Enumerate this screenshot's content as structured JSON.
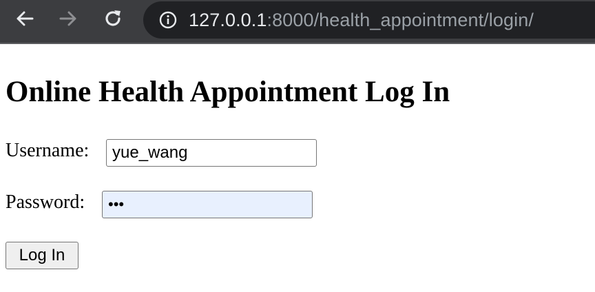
{
  "browser": {
    "url_host": "127.0.0.1",
    "url_path": ":8000/health_appointment/login/",
    "icons": [
      "back-arrow-icon",
      "forward-arrow-icon",
      "reload-icon",
      "site-info-icon"
    ]
  },
  "page": {
    "title": "Online Health Appointment Log In",
    "username_label": "Username:",
    "username_value": "yue_wang",
    "password_label": "Password:",
    "password_value_masked": "•••",
    "login_button": "Log In"
  },
  "colors": {
    "toolbar_bg": "#3c3d40",
    "omnibox_bg": "#202124",
    "autofill_bg": "#e8f0fe"
  }
}
